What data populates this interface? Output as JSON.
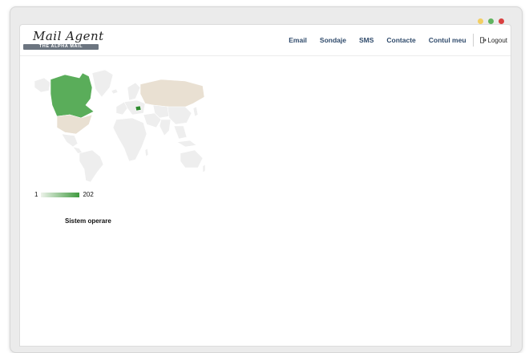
{
  "window": {
    "controls": [
      "minimize",
      "maximize",
      "close"
    ]
  },
  "logo": {
    "script": "Mail Agent",
    "tagline": "THE ALPHA MAIL"
  },
  "nav": {
    "items": [
      "Email",
      "Sondaje",
      "SMS",
      "Contacte",
      "Contul meu"
    ],
    "logout": "Logout"
  },
  "map": {
    "legend_min": "1",
    "legend_max": "202",
    "colors": {
      "high": "#5aad5a",
      "low": "#e9e0d2",
      "none": "#eeeeee"
    }
  },
  "section": {
    "title": "Sistem operare"
  }
}
